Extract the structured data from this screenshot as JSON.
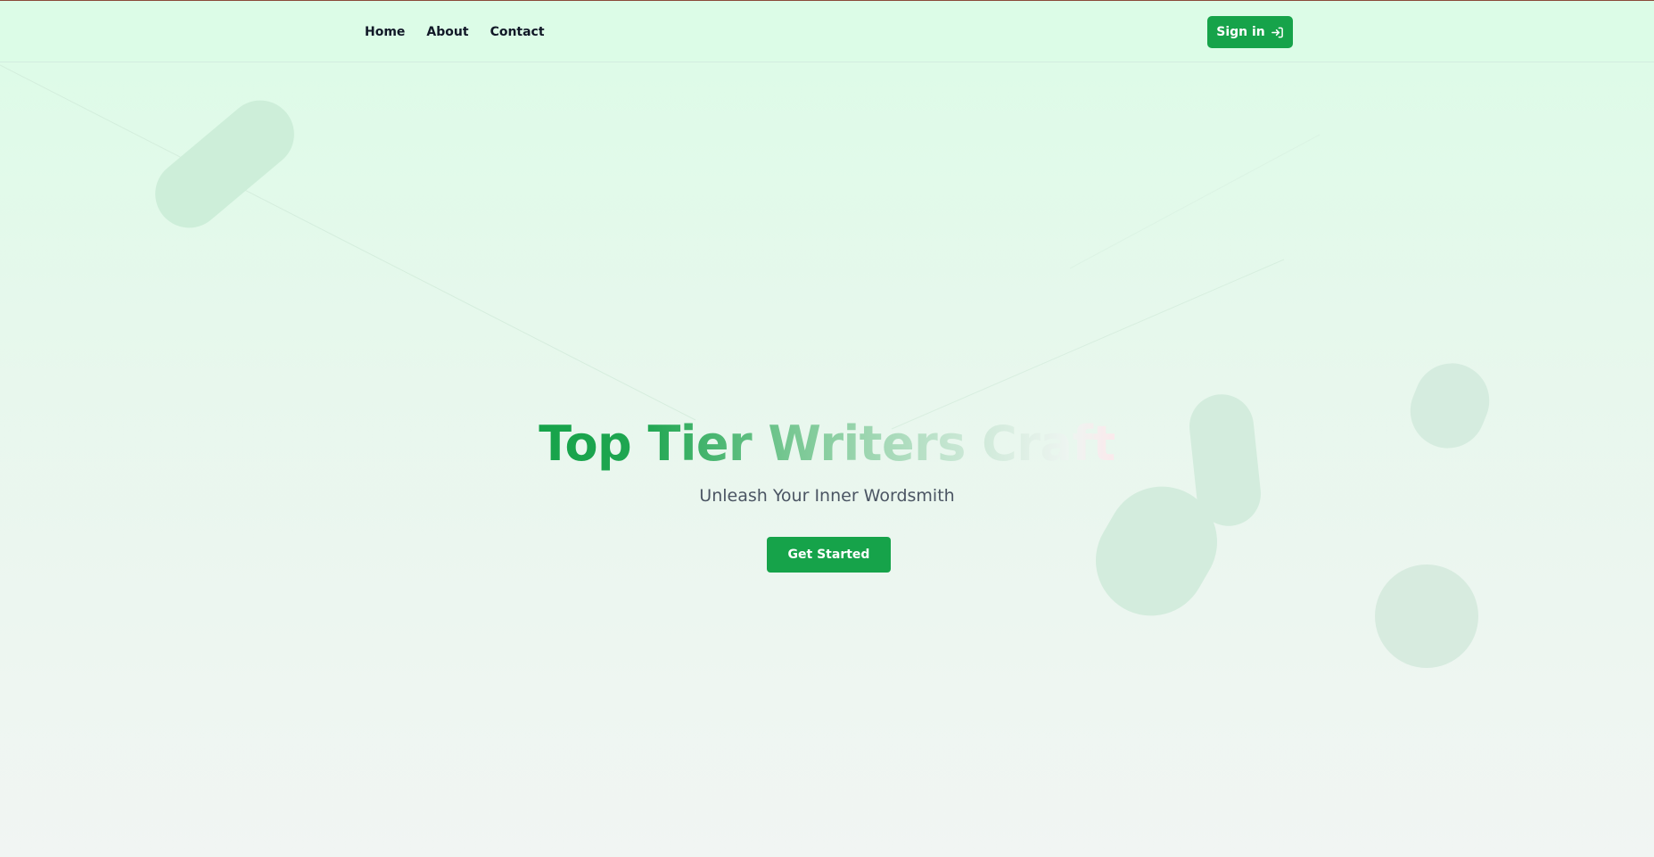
{
  "nav": {
    "links": [
      "Home",
      "About",
      "Contact"
    ],
    "signin_label": "Sign in",
    "signin_icon": "sign-in-arrow-icon"
  },
  "hero": {
    "title": "Top Tier Writers Craft",
    "subtitle": "Unleash Your Inner Wordsmith",
    "cta_label": "Get Started"
  },
  "colors": {
    "brand_green": "#16a34a",
    "background_top": "#dcfce7",
    "background_bottom": "#f1f5f3",
    "subtitle_gray": "#4b5563"
  }
}
